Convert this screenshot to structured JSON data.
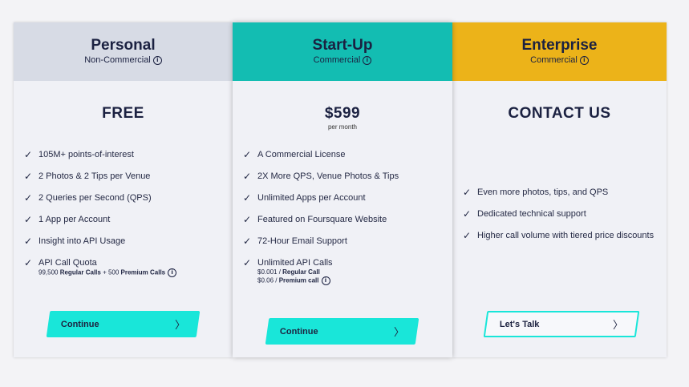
{
  "plans": [
    {
      "name": "Personal",
      "subtitle": "Non-Commercial",
      "price": "FREE",
      "features": [
        "105M+ points-of-interest",
        "2 Photos & 2 Tips per Venue",
        "2 Queries per Second (QPS)",
        "1 App per Account",
        "Insight into API Usage",
        "API Call Quota"
      ],
      "quota_note": {
        "a": "99,500 ",
        "b": "Regular Calls",
        "c": " + 500 ",
        "d": "Premium Calls"
      },
      "button": "Continue"
    },
    {
      "name": "Start-Up",
      "subtitle": "Commercial",
      "price": "$599",
      "price_period": "per month",
      "features": [
        "A Commercial License",
        "2X More QPS, Venue Photos & Tips",
        "Unlimited Apps per Account",
        "Featured on Foursquare Website",
        "72-Hour Email Support",
        "Unlimited API Calls"
      ],
      "calls_note": {
        "r1": "$0.001 / ",
        "r1b": "Regular Call",
        "r2": "$0.06 / ",
        "r2b": "Premium call"
      },
      "button": "Continue"
    },
    {
      "name": "Enterprise",
      "subtitle": "Commercial",
      "price": "CONTACT US",
      "features": [
        "Even more photos, tips, and QPS",
        "Dedicated technical support",
        "Higher call volume with tiered price discounts"
      ],
      "button": "Let's Talk"
    }
  ],
  "icons": {
    "check": "checkmark-icon",
    "info": "info-icon",
    "chevron": "chevron-right-icon"
  },
  "colors": {
    "personal": "#d7dbe5",
    "startup": "#13bdb2",
    "enterprise": "#ecb319",
    "button": "#19e6d9"
  }
}
